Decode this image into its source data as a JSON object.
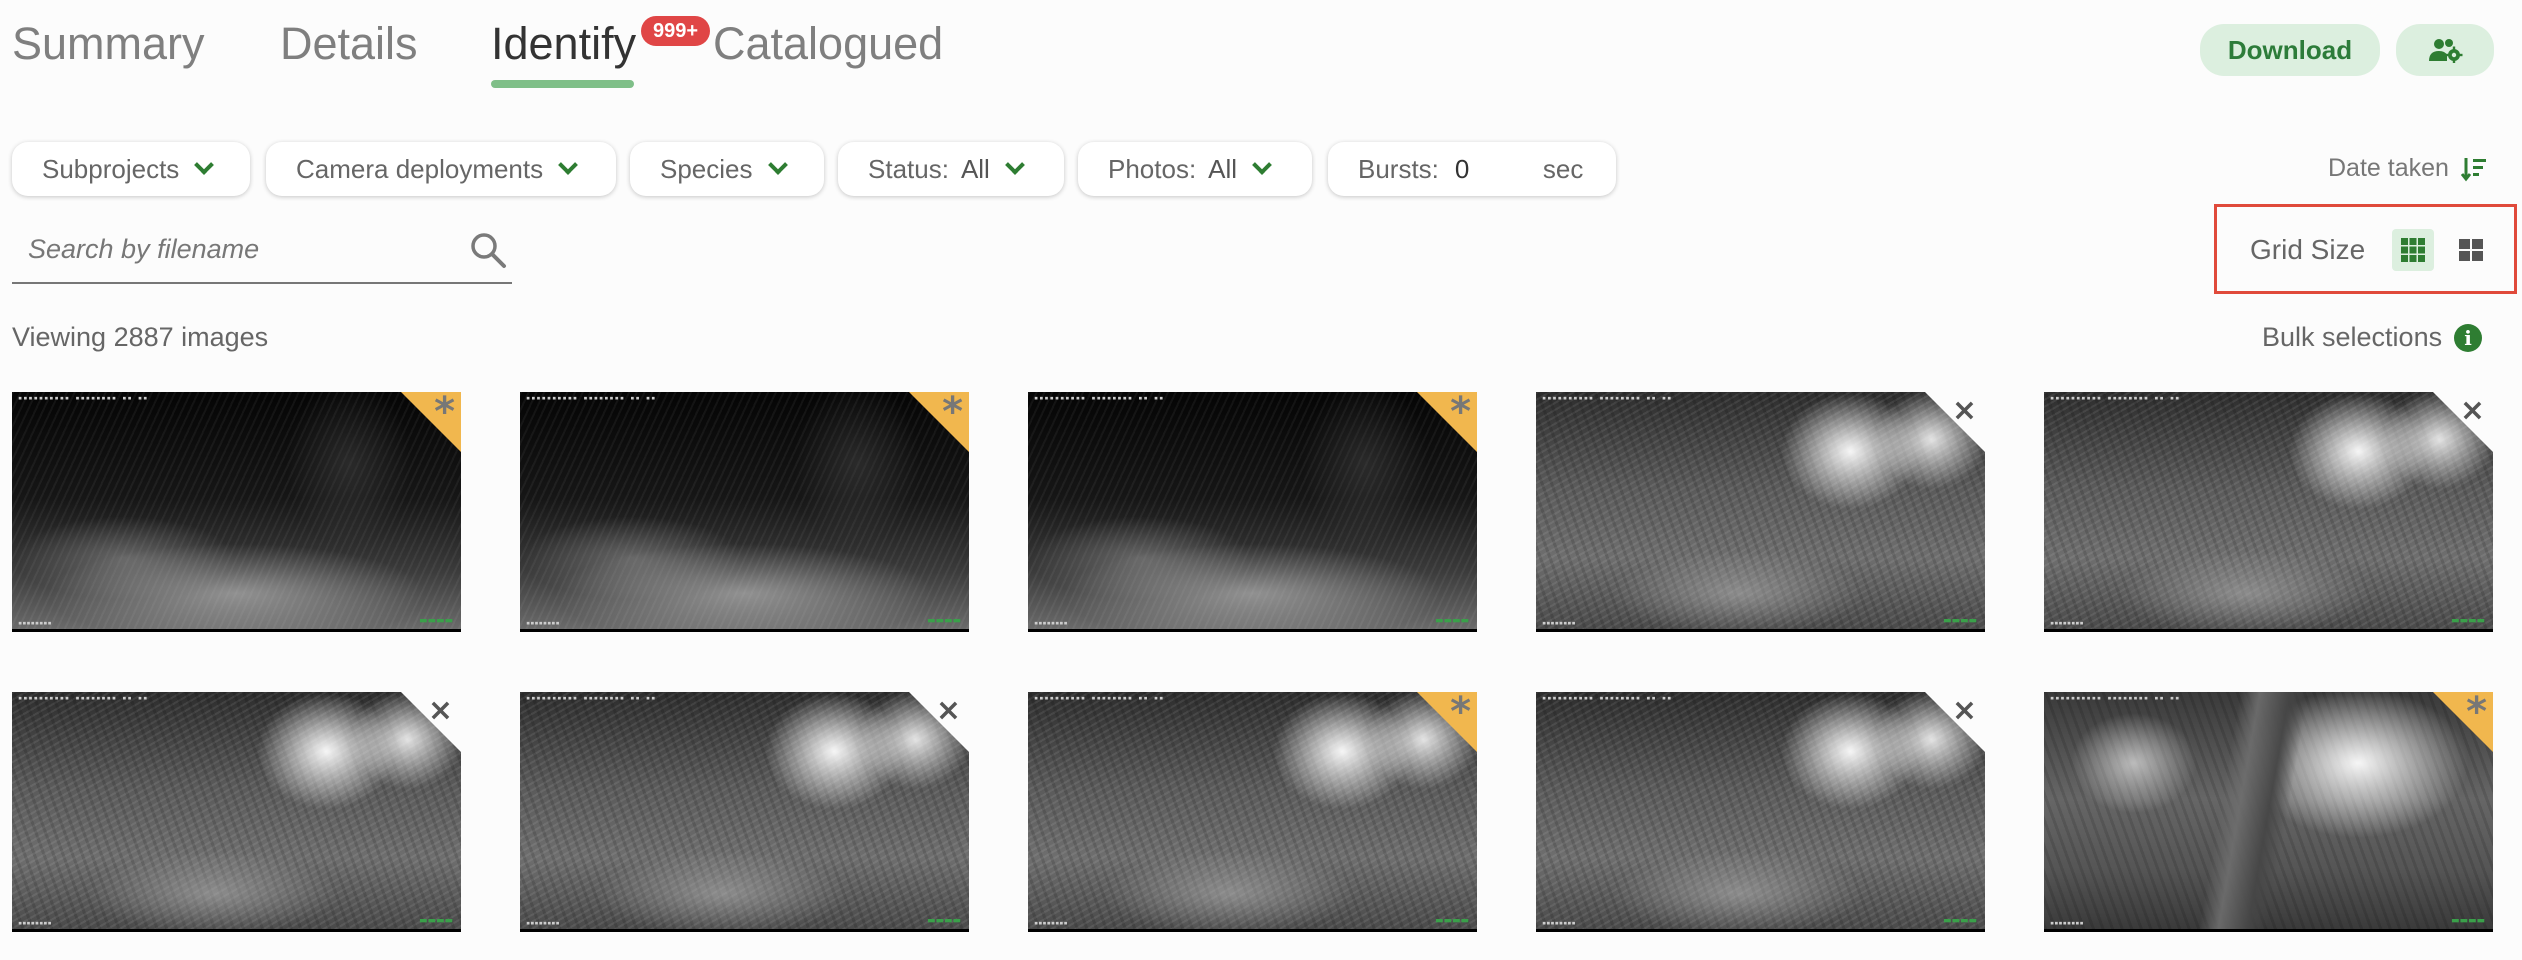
{
  "tabs": {
    "summary": "Summary",
    "details": "Details",
    "identify": "Identify",
    "identify_badge": "999+",
    "catalogued": "Catalogued"
  },
  "header": {
    "download_label": "Download",
    "manage_users_icon": "users-gear-icon"
  },
  "filters": {
    "subprojects": "Subprojects",
    "camera_deployments": "Camera deployments",
    "species": "Species",
    "status_label": "Status:",
    "status_value": "All",
    "photos_label": "Photos:",
    "photos_value": "All",
    "bursts_label": "Bursts:",
    "bursts_value": "0",
    "bursts_unit": "sec"
  },
  "sort": {
    "label": "Date taken",
    "icon": "sort-descending-icon"
  },
  "search": {
    "placeholder": "Search by filename",
    "value": ""
  },
  "grid_size": {
    "label": "Grid Size",
    "options": [
      "small-grid",
      "large-grid"
    ],
    "selected": "small-grid"
  },
  "results": {
    "viewing_text": "Viewing 2887 images",
    "bulk_label": "Bulk selections"
  },
  "thumbnails": [
    {
      "scene": "dark",
      "marker": "star"
    },
    {
      "scene": "dark",
      "marker": "star"
    },
    {
      "scene": "dark",
      "marker": "star"
    },
    {
      "scene": "light",
      "marker": "x"
    },
    {
      "scene": "light",
      "marker": "x"
    },
    {
      "scene": "light",
      "marker": "x"
    },
    {
      "scene": "light",
      "marker": "x"
    },
    {
      "scene": "light",
      "marker": "star"
    },
    {
      "scene": "light",
      "marker": "x"
    },
    {
      "scene": "trunk",
      "marker": "star"
    }
  ],
  "colors": {
    "accent_green": "#2e7d32",
    "star_corner": "#f1b74e",
    "badge_red": "#e04646",
    "highlight_box": "#e04a3b"
  }
}
